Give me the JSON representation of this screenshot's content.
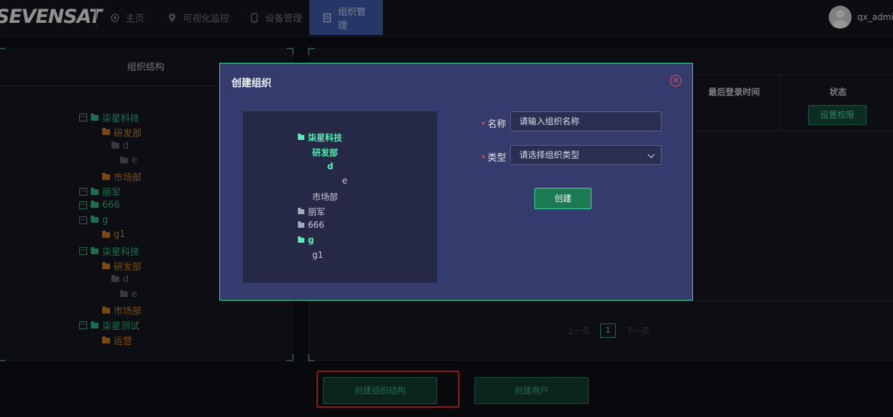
{
  "brand": {
    "logo_text": "SEVENSAT"
  },
  "nav": {
    "items": [
      {
        "label": "主页",
        "icon": "home-icon"
      },
      {
        "label": "可视化监控",
        "icon": "location-pin-icon"
      },
      {
        "label": "设备管理",
        "icon": "device-icon"
      },
      {
        "label": "组织管理",
        "icon": "document-icon",
        "active": true
      }
    ]
  },
  "user": {
    "name": "qx_admin"
  },
  "left_panel": {
    "title": "组织结构",
    "tree": [
      {
        "label": "柒星科技",
        "level": 0,
        "toggle": "−"
      },
      {
        "label": "研发部",
        "level": 1
      },
      {
        "label": "d",
        "level": 2
      },
      {
        "label": "e",
        "level": 3
      },
      {
        "label": "市场部",
        "level": 1
      },
      {
        "label": "丽军",
        "level": 0,
        "toggle": "−"
      },
      {
        "label": "666",
        "level": 0,
        "toggle": "−"
      },
      {
        "label": "g",
        "level": 0,
        "toggle": "−"
      },
      {
        "label": "g1",
        "level": 1
      },
      {
        "label": "柒星科技",
        "level": 0,
        "toggle": "−"
      },
      {
        "label": "研发部",
        "level": 1
      },
      {
        "label": "d",
        "level": 2
      },
      {
        "label": "e",
        "level": 3
      },
      {
        "label": "市场部",
        "level": 1
      },
      {
        "label": "柒星测试",
        "level": 0,
        "toggle": "−"
      },
      {
        "label": "运营",
        "level": 1
      }
    ]
  },
  "table": {
    "columns": [
      "最后登录时间",
      "状态"
    ],
    "row_action": "设置权限"
  },
  "pagination": {
    "prev": "上一页",
    "current": "1",
    "next": "下一页"
  },
  "bottom_actions": {
    "create_org_structure": "创建组织结构",
    "create_user": "创建用户"
  },
  "modal": {
    "title": "创建组织",
    "preview": [
      {
        "label": "柒星科技",
        "style": "green",
        "folder": true
      },
      {
        "label": "研发部",
        "style": "green",
        "folder": false
      },
      {
        "label": "d",
        "style": "green",
        "folder": false
      },
      {
        "label": "e",
        "style": "plain",
        "folder": false
      },
      {
        "label": "市场部",
        "style": "plain",
        "folder": false
      },
      {
        "label": "丽军",
        "style": "plain",
        "folder": true
      },
      {
        "label": "666",
        "style": "plain",
        "folder": true
      },
      {
        "label": "g",
        "style": "green",
        "folder": true
      },
      {
        "label": "g1",
        "style": "plain",
        "folder": false
      }
    ],
    "form": {
      "name_label": "名称",
      "name_placeholder": "请输入组织名称",
      "type_label": "类型",
      "type_placeholder": "请选择组织类型",
      "required_mark": "*",
      "submit": "创建"
    }
  },
  "colors": {
    "accent_green": "#2db37e",
    "nav_active": "#3b5aa6",
    "modal_bg": "#353b6c",
    "highlight_red": "#e02828"
  }
}
